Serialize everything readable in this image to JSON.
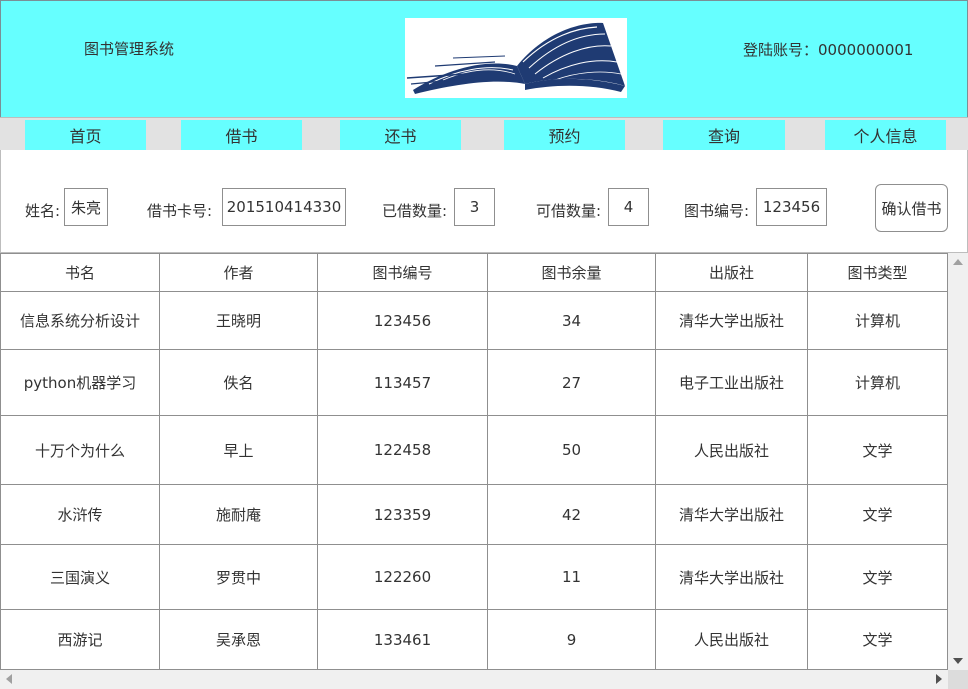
{
  "header": {
    "app_title": "图书管理系统",
    "account_label": "登陆账号：",
    "account_value": "0000000001",
    "logo_icon": "open-book-logo"
  },
  "nav": {
    "items": [
      {
        "label": "首页"
      },
      {
        "label": "借书"
      },
      {
        "label": "还书"
      },
      {
        "label": "预约"
      },
      {
        "label": "查询"
      },
      {
        "label": "个人信息"
      }
    ]
  },
  "form": {
    "name_label": "姓名:",
    "name_value": "朱亮",
    "card_label": "借书卡号:",
    "card_value": "201510414330",
    "borrowed_label": "已借数量:",
    "borrowed_value": "3",
    "available_label": "可借数量:",
    "available_value": "4",
    "book_id_label": "图书编号:",
    "book_id_value": "123456",
    "confirm_label": "确认借书"
  },
  "table": {
    "columns": [
      "书名",
      "作者",
      "图书编号",
      "图书余量",
      "出版社",
      "图书类型"
    ],
    "rows": [
      [
        "信息系统分析设计",
        "王晓明",
        "123456",
        "34",
        "清华大学出版社",
        "计算机"
      ],
      [
        "python机器学习",
        "佚名",
        "113457",
        "27",
        "电子工业出版社",
        "计算机"
      ],
      [
        "十万个为什么",
        "早上",
        "122458",
        "50",
        "人民出版社",
        "文学"
      ],
      [
        "水浒传",
        "施耐庵",
        "123359",
        "42",
        "清华大学出版社",
        "文学"
      ],
      [
        "三国演义",
        "罗贯中",
        "122260",
        "11",
        "清华大学出版社",
        "文学"
      ],
      [
        "西游记",
        "吴承恩",
        "133461",
        "9",
        "人民出版社",
        "文学"
      ]
    ]
  },
  "colors": {
    "accent": "#66ffff",
    "nav_bar": "#e2e2e2",
    "logo_ink": "#1f3b73"
  }
}
